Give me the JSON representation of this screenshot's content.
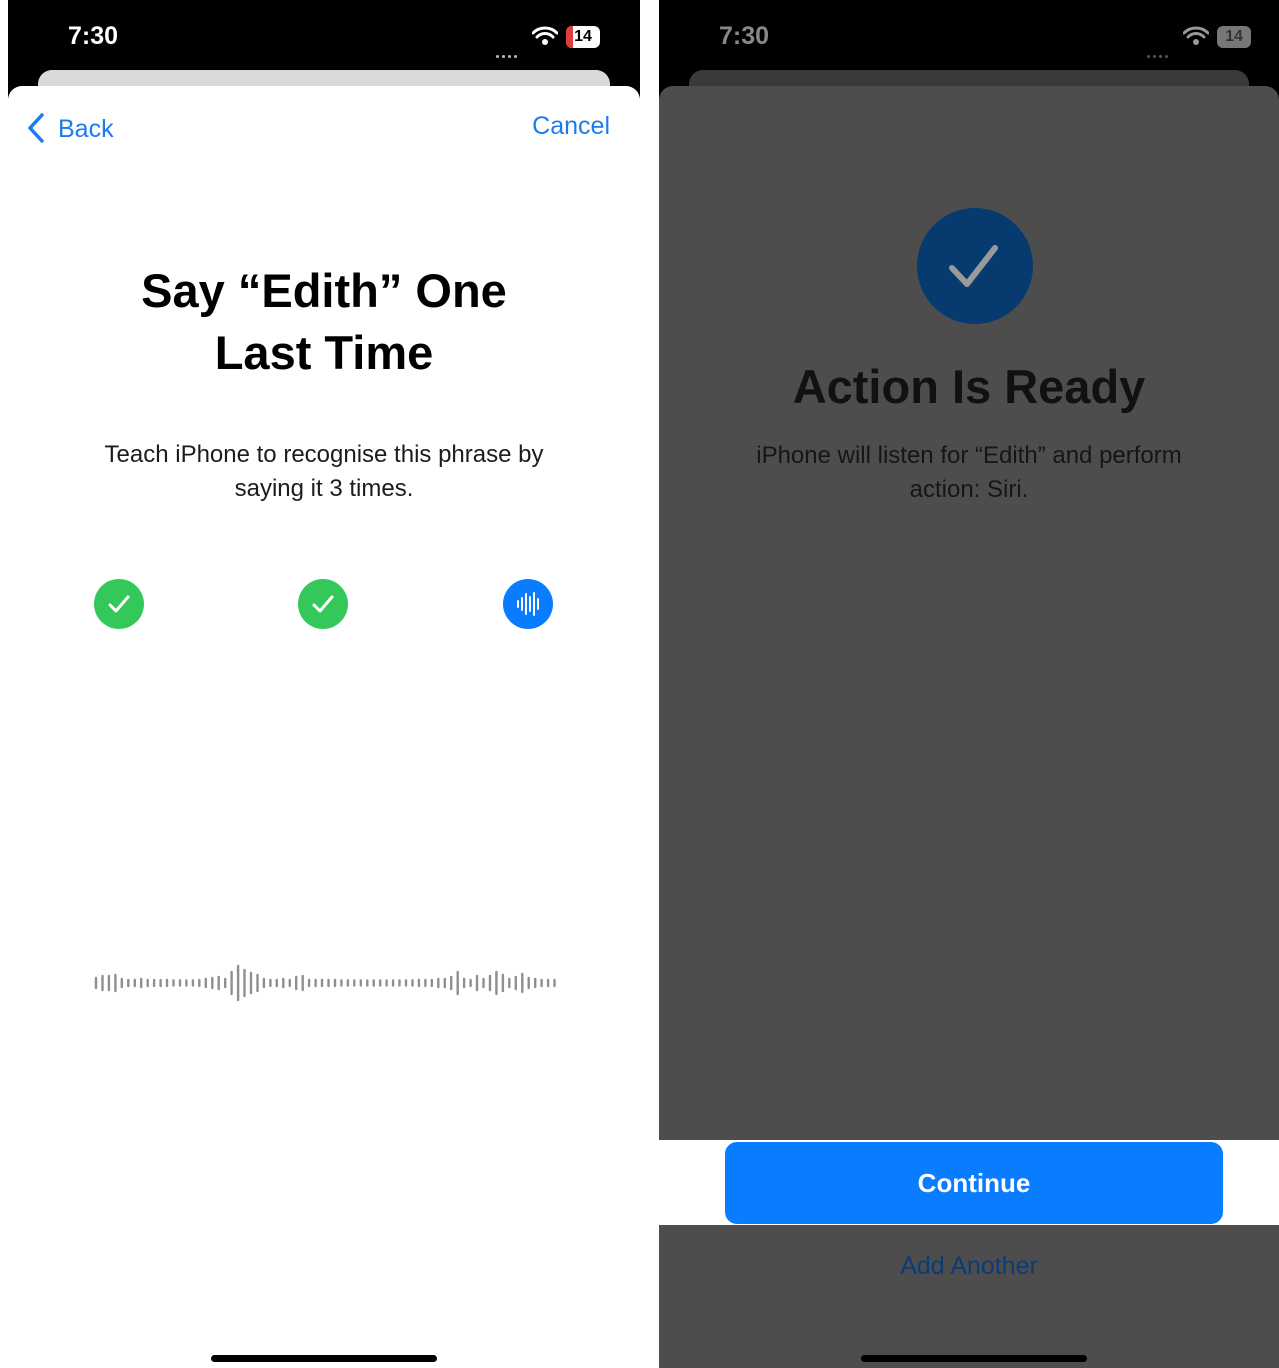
{
  "left_screen": {
    "status": {
      "time": "7:30",
      "battery": "14"
    },
    "nav": {
      "back_label": "Back",
      "cancel_label": "Cancel"
    },
    "title_line1": "Say “Edith” One",
    "title_line2": "Last Time",
    "subtitle": "Teach iPhone to recognise this phrase by saying it 3 times.",
    "progress": {
      "total": 3,
      "completed": 2,
      "current_state": "listening"
    }
  },
  "right_screen": {
    "status": {
      "time": "7:30",
      "battery": "14"
    },
    "title": "Action Is Ready",
    "subtitle": "iPhone will listen for “Edith” and perform action: Siri.",
    "continue_label": "Continue",
    "add_another_label": "Add Another"
  },
  "colors": {
    "accent_blue": "#0a7cff",
    "success_green": "#34c759",
    "overlay_gray": "#4d4d4d",
    "check_circle": "#073a6e",
    "battery_low": "#e23b3b"
  },
  "icons": [
    "chevron-left-icon",
    "wifi-icon",
    "signal-icon",
    "battery-icon",
    "checkmark-icon",
    "waveform-icon"
  ]
}
